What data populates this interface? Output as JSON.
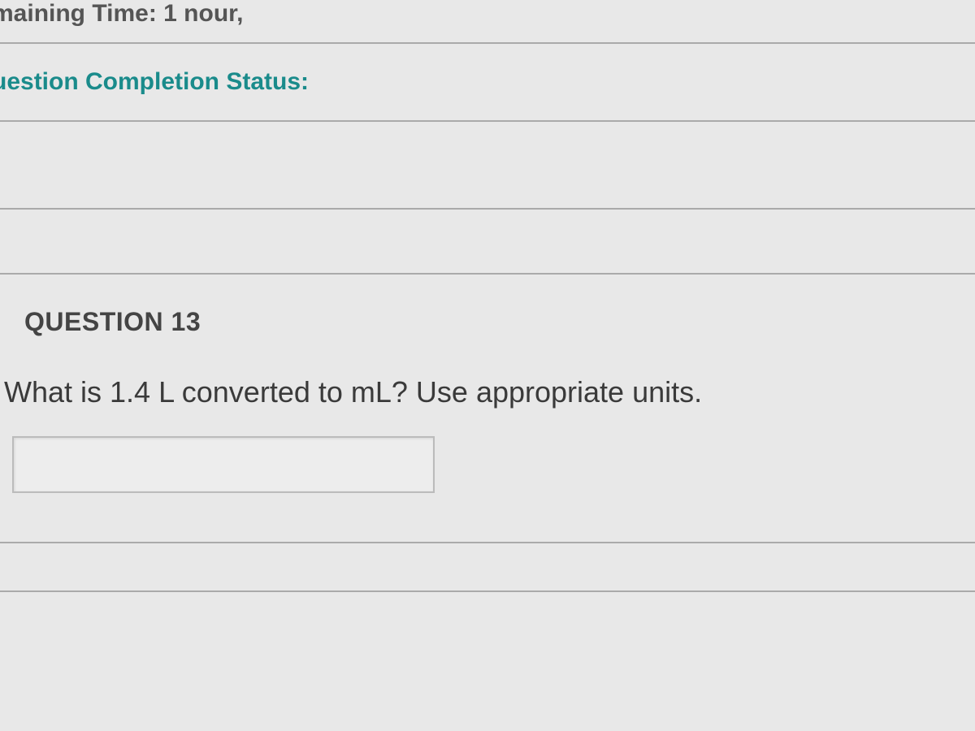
{
  "header": {
    "remaining_time_label": "maining Time: 1 nour,"
  },
  "status": {
    "label": "uestion Completion Status:"
  },
  "question": {
    "number_label": "QUESTION 13",
    "text": "What is  1.4 L converted to mL? Use appropriate units.",
    "answer_value": ""
  }
}
